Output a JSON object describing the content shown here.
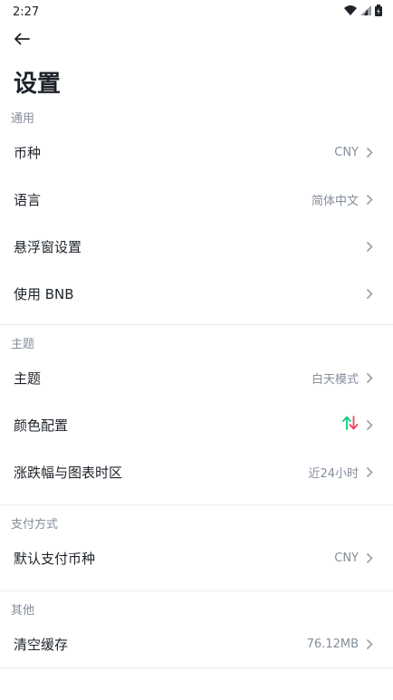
{
  "status": {
    "time": "2:27"
  },
  "page": {
    "title": "设置"
  },
  "sections": [
    {
      "title": "通用",
      "items": [
        {
          "label": "币种",
          "value": "CNY"
        },
        {
          "label": "语言",
          "value": "简体中文"
        },
        {
          "label": "悬浮窗设置",
          "value": ""
        },
        {
          "label": "使用 BNB",
          "value": ""
        }
      ]
    },
    {
      "title": "主题",
      "items": [
        {
          "label": "主题",
          "value": "白天模式"
        },
        {
          "label": "颜色配置",
          "value": "",
          "icon": "up-down-arrows-icon"
        },
        {
          "label": "涨跌幅与图表时区",
          "value": "近24小时"
        }
      ]
    },
    {
      "title": "支付方式",
      "items": [
        {
          "label": "默认支付币种",
          "value": "CNY"
        }
      ]
    },
    {
      "title": "其他",
      "items": [
        {
          "label": "清空缓存",
          "value": "76.12MB"
        }
      ]
    }
  ],
  "colors": {
    "up": "#0ecb81",
    "down": "#f6465d",
    "text": "#1e2329",
    "muted": "#848e9c"
  }
}
